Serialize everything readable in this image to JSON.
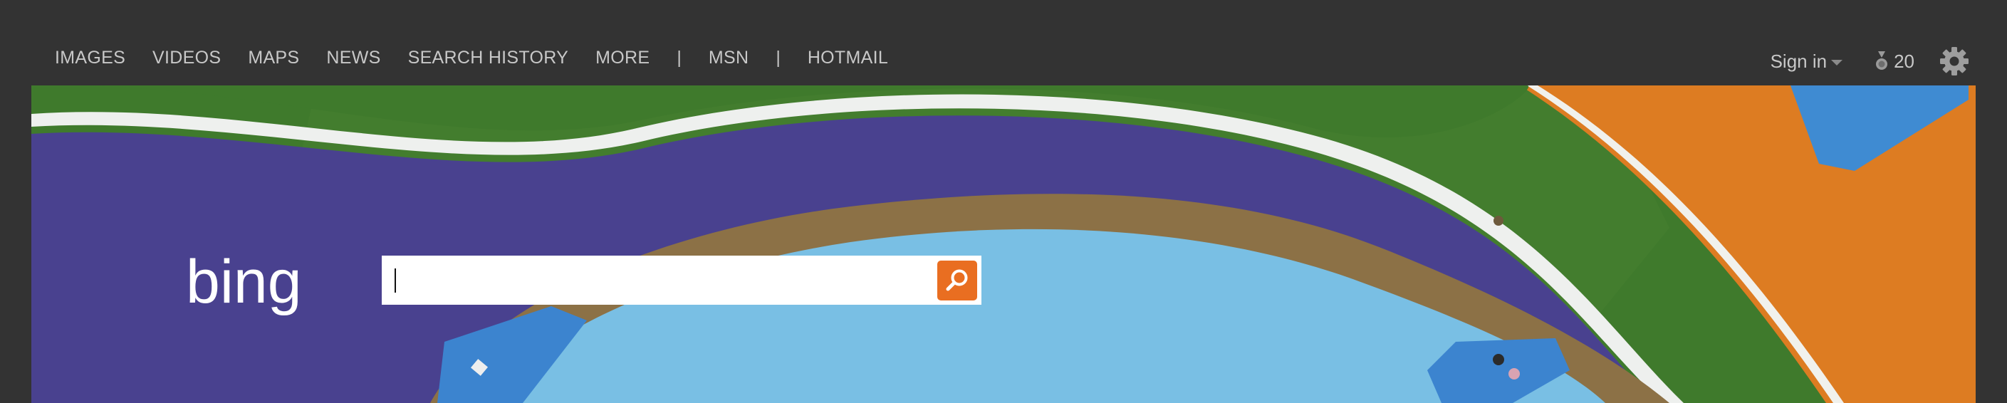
{
  "nav": {
    "links": [
      {
        "label": "IMAGES"
      },
      {
        "label": "VIDEOS"
      },
      {
        "label": "MAPS"
      },
      {
        "label": "NEWS"
      },
      {
        "label": "SEARCH HISTORY"
      },
      {
        "label": "MORE"
      }
    ],
    "separator": "|",
    "msn_label": "MSN",
    "hotmail_label": "HOTMAIL"
  },
  "account": {
    "signin_label": "Sign in",
    "rewards_count": "20",
    "rewards_icon": "medal-icon",
    "settings_icon": "gear-icon"
  },
  "search": {
    "value": "",
    "button_icon": "search-icon",
    "accent_color": "#e96e21"
  },
  "logo": {
    "text": "bing"
  }
}
